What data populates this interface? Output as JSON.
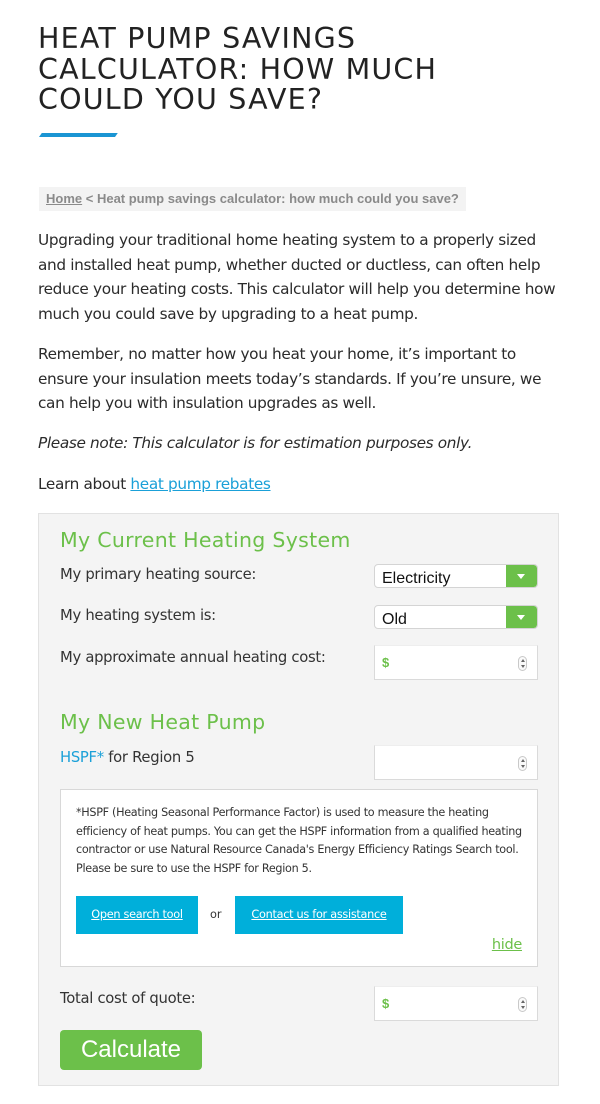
{
  "header": {
    "title": "HEAT PUMP SAVINGS CALCULATOR: HOW MUCH COULD YOU SAVE?",
    "accent_color": "#1a95d3"
  },
  "breadcrumb": {
    "home": "Home",
    "separator": " < ",
    "current": "Heat pump savings calculator: how much could you save?"
  },
  "intro": {
    "paragraph1": "Upgrading your traditional home heating system to a properly sized and installed heat pump, whether ducted or ductless, can often help reduce your heating costs. This calculator will help you determine how much you could save by upgrading to a heat pump.",
    "paragraph2": "Remember, no matter how you heat your home, it’s important to ensure your insulation meets today’s standards. If you’re unsure, we can help you with insulation upgrades as well.",
    "note": "Please note: This calculator is for estimation purposes only.",
    "learn_prefix": "Learn about ",
    "learn_link": "heat pump rebates"
  },
  "calculator": {
    "accent_color": "#6cc04a",
    "current_system": {
      "title": "My Current Heating System",
      "source_label": "My primary heating source:",
      "source_value": "Electricity",
      "age_label": "My heating system is:",
      "age_value": "Old",
      "cost_label": "My approximate annual heating cost:",
      "cost_prefix": "$",
      "cost_value": ""
    },
    "new_pump": {
      "title": "My New Heat Pump",
      "hspf_link": "HSPF*",
      "hspf_label_suffix": " for Region 5",
      "hspf_value": "",
      "info_text": "*HSPF (Heating Seasonal Performance Factor) is used to measure the heating efficiency of heat pumps. You can get the HSPF information from a qualified heating contractor or use Natural Resource Canada's Energy Efficiency Ratings Search tool. Please be sure to use the HSPF for Region 5.",
      "search_button": "Open search tool",
      "or_text": "or",
      "contact_button": "Contact us for assistance",
      "hide_link": "hide",
      "quote_label": "Total cost of quote:",
      "quote_prefix": "$",
      "quote_value": ""
    },
    "calculate_button": "Calculate"
  }
}
